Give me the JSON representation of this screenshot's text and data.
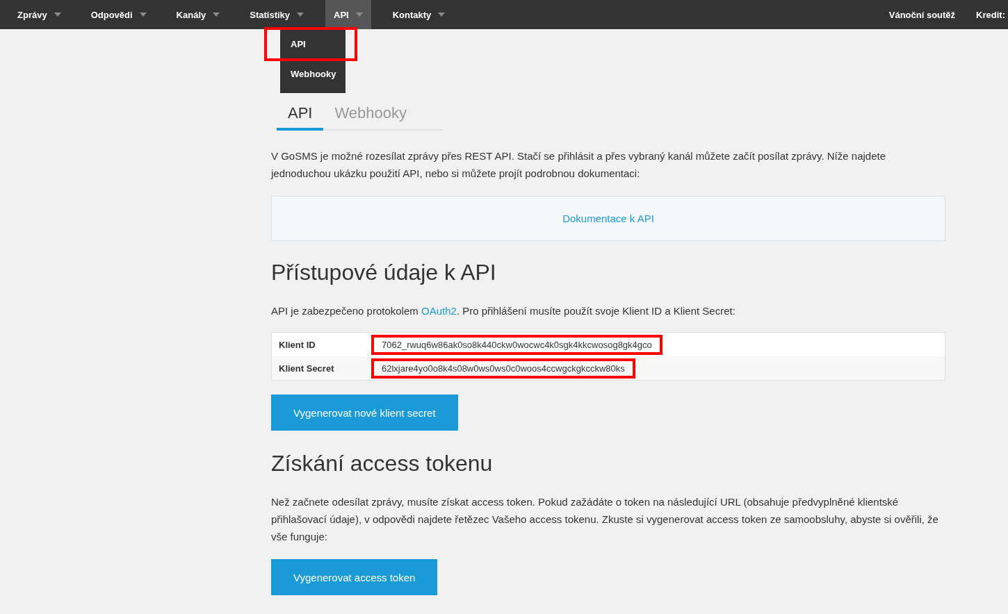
{
  "nav": {
    "items": [
      {
        "label": "Zprávy",
        "selected": false
      },
      {
        "label": "Odpovědi",
        "selected": false
      },
      {
        "label": "Kanály",
        "selected": false
      },
      {
        "label": "Statistiky",
        "selected": false
      },
      {
        "label": "API",
        "selected": true
      },
      {
        "label": "Kontakty",
        "selected": false
      }
    ],
    "right": [
      "Vánoční soutěž",
      "Kredit:"
    ],
    "dropdown": [
      {
        "label": "API",
        "highlighted": true
      },
      {
        "label": "Webhooky",
        "highlighted": false
      }
    ]
  },
  "tabs": [
    {
      "label": "API",
      "selected": true
    },
    {
      "label": "Webhooky",
      "selected": false
    }
  ],
  "intro": "V GoSMS je možné rozesílat zprávy přes REST API. Stačí se přihlásit a přes vybraný kanál můžete začít posílat zprávy. Níže najdete jednoduchou ukázku použití API, nebo si můžete projít podrobnou dokumentaci:",
  "doc_link": "Dokumentace k API",
  "credentials": {
    "heading": "Přístupové údaje k API",
    "text_before": "API je zabezpečeno protokolem ",
    "link": "OAuth2",
    "text_after": ". Pro přihlášení musíte použít svoje Klient ID a Klient Secret:",
    "rows": [
      {
        "label": "Klient ID",
        "value": "7062_rwuq6w86ak0so8k440ckw0wocwc4k0sgk4kkcwosog8gk4gco",
        "highlighted": true
      },
      {
        "label": "Klient Secret",
        "value": "62lxjare4yo0o8k4s08w0ws0ws0c0woos4ccwgckgkcckw80ks",
        "highlighted": true
      }
    ],
    "button": "Vygenerovat nové klient secret"
  },
  "token": {
    "heading": "Získání access tokenu",
    "text": "Než začnete odesílat zprávy, musíte získat access token. Pokud zažádáte o token na následující URL (obsahuje předvyplněné klientské přihlašovací údaje), v odpovědi najdete řetězec Vašeho access tokenu. Zkuste si vygenerovat access token ze samoobsluhy, abyste si ověřili, že vše funguje:",
    "button": "Vygenerovat access token"
  }
}
